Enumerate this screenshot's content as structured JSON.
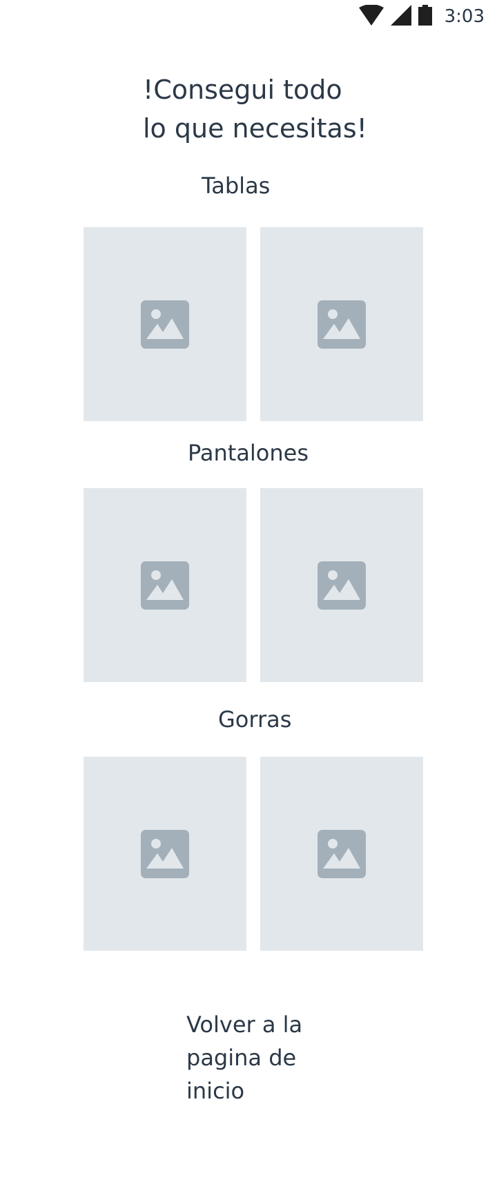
{
  "status_bar": {
    "time": "3:03",
    "icons": [
      "wifi-icon",
      "signal-icon",
      "battery-icon"
    ]
  },
  "title": {
    "line1": "!Consegui todo",
    "line2": "lo que necesitas!"
  },
  "sections": [
    {
      "label": "Tablas"
    },
    {
      "label": "Pantalones"
    },
    {
      "label": "Gorras"
    }
  ],
  "image_placeholder_icon": "image-placeholder-icon",
  "footer": {
    "back_label": "Volver a la pagina de inicio"
  },
  "colors": {
    "text": "#2b3847",
    "tile_bg": "#e2e7eb",
    "placeholder_icon": "#a3b0ba"
  }
}
